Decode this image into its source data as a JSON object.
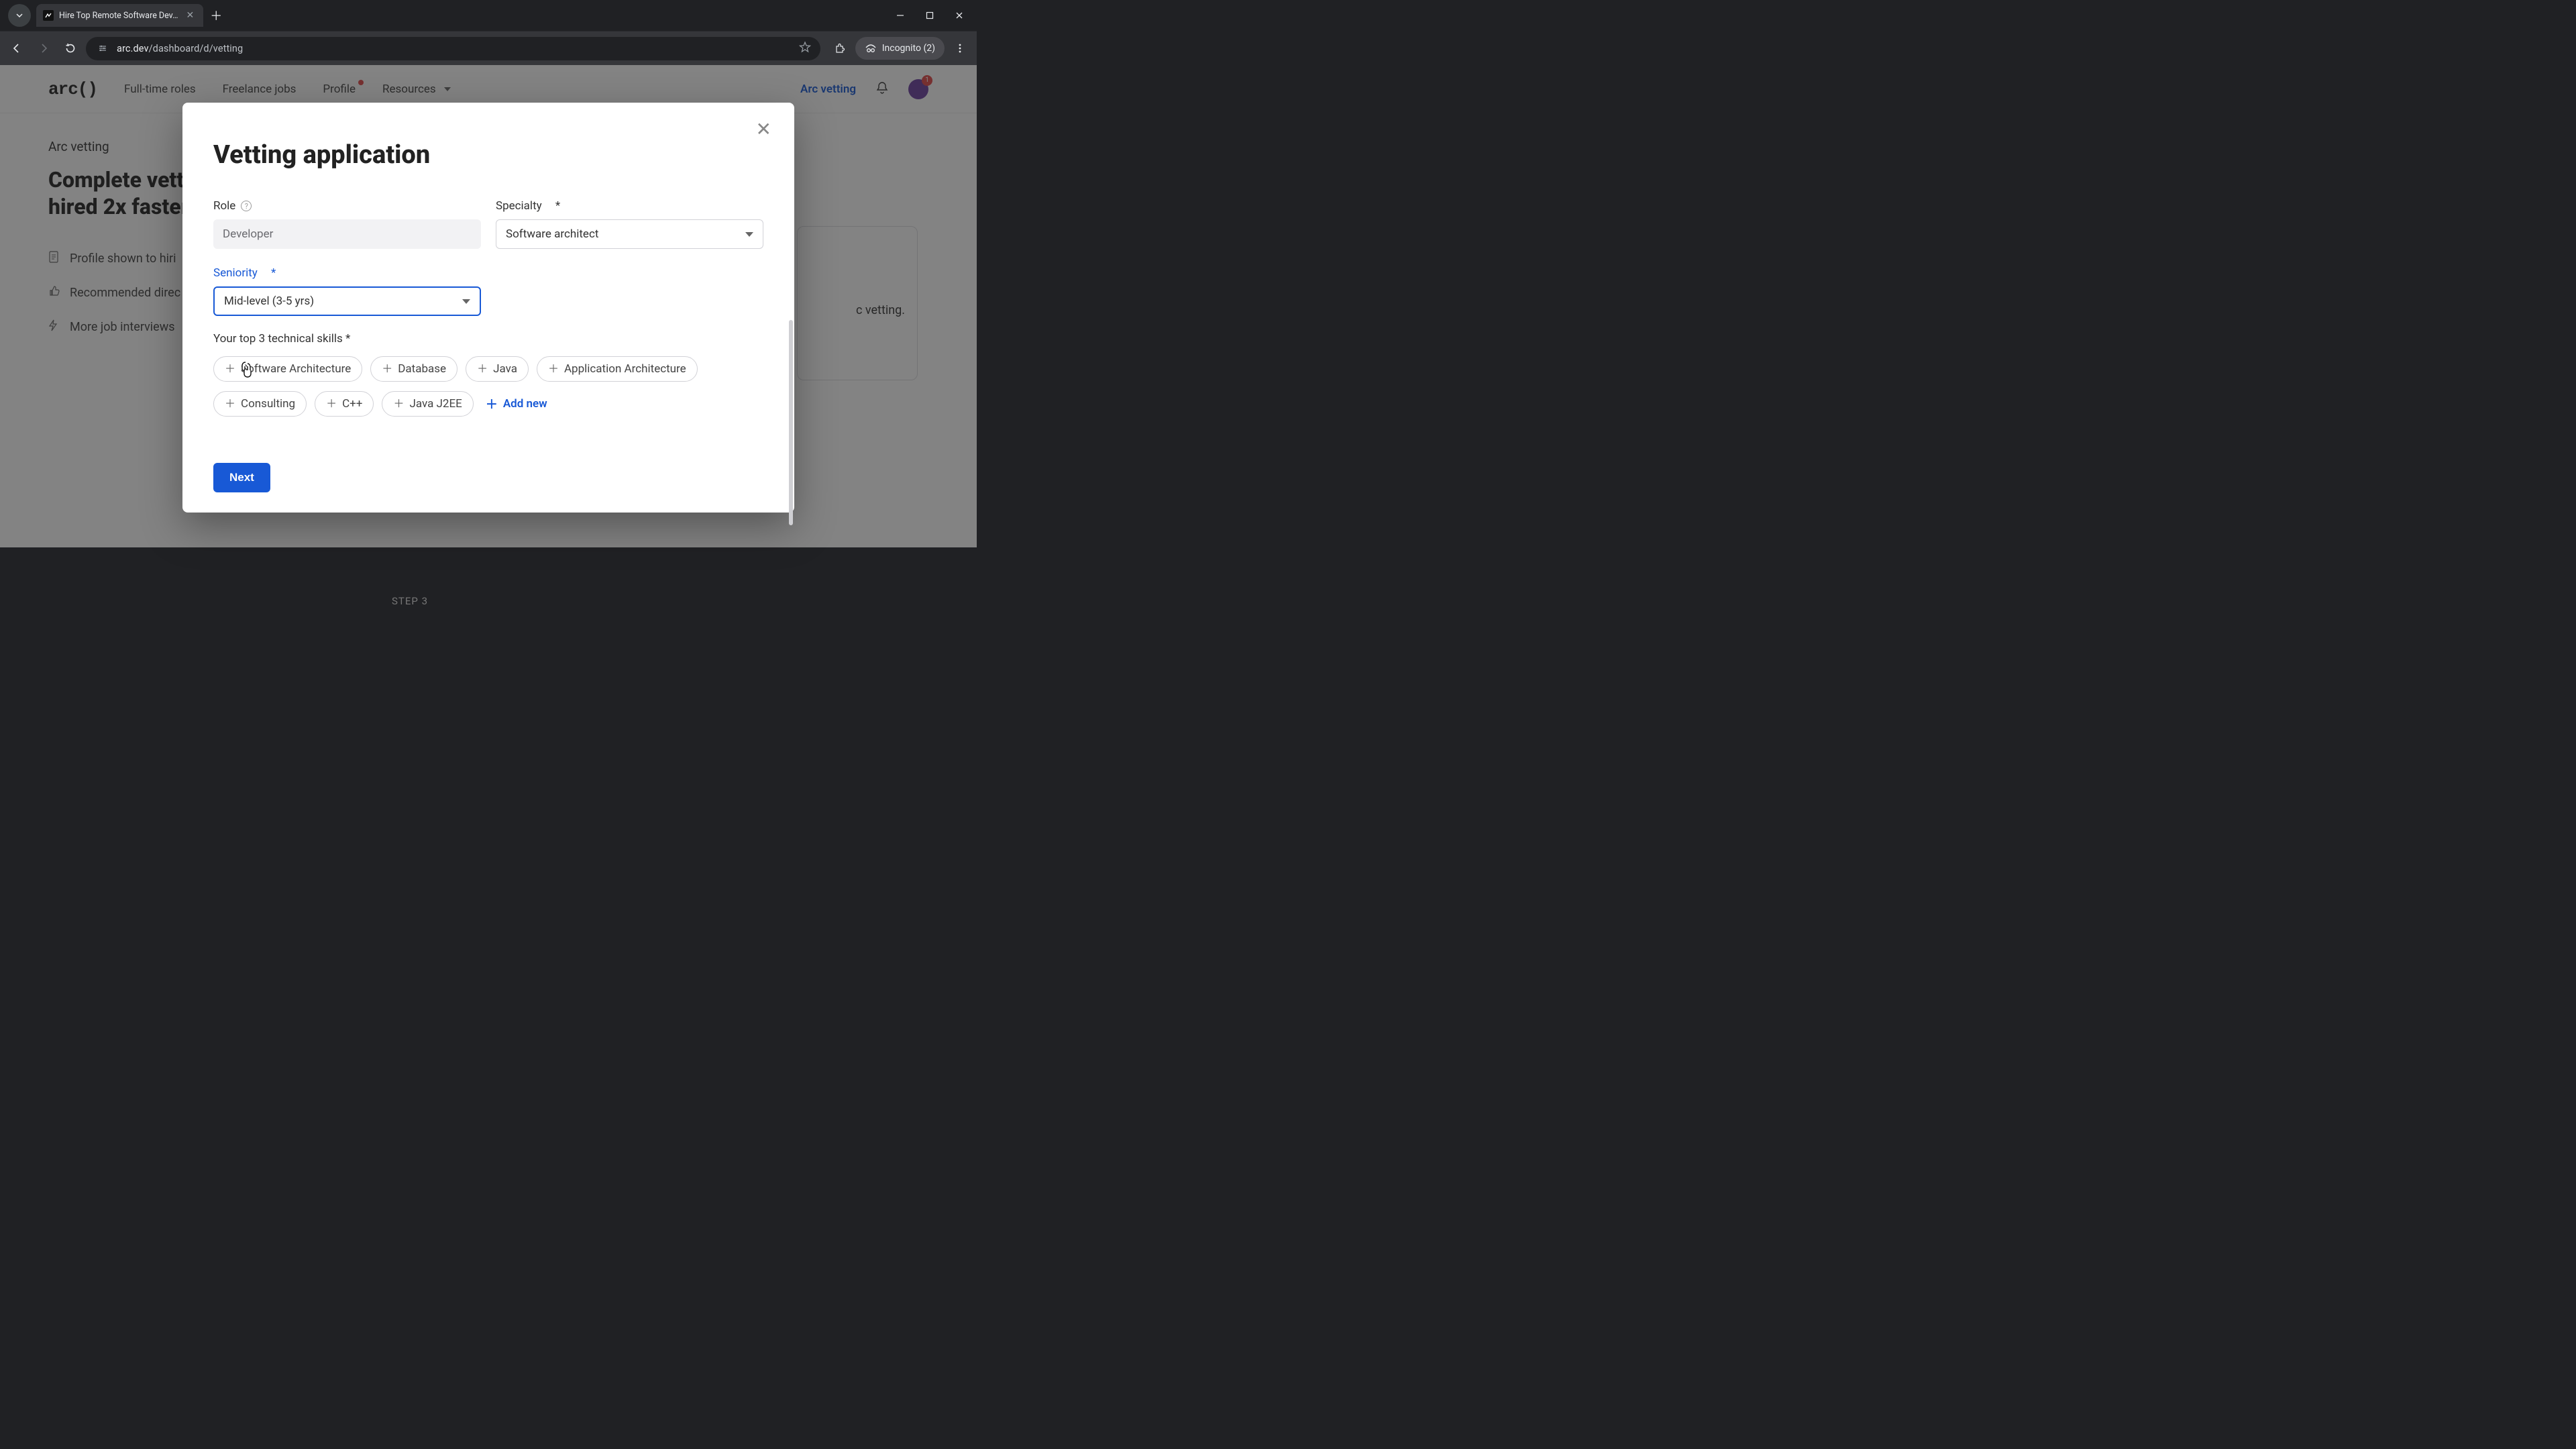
{
  "browser": {
    "tab_title": "Hire Top Remote Software Dev…",
    "url_display_host": "arc.dev",
    "url_display_path": "/dashboard/d/vetting",
    "incognito_label": "Incognito (2)"
  },
  "header": {
    "logo": "arc()",
    "nav": {
      "full_time": "Full-time roles",
      "freelance": "Freelance jobs",
      "profile": "Profile",
      "resources": "Resources"
    },
    "right": {
      "arc_vetting": "Arc vetting",
      "avatar_badge": "1"
    }
  },
  "page": {
    "section_label": "Arc vetting",
    "heading_line1": "Complete vetti",
    "heading_line2": "hired 2x faster",
    "benefits": {
      "profile": "Profile shown to hiri",
      "recommended": "Recommended direc",
      "interviews": "More job interviews"
    },
    "right_card_text": "c vetting.",
    "step_label": "STEP 3"
  },
  "modal": {
    "title": "Vetting application",
    "fields": {
      "role_label": "Role",
      "role_value": "Developer",
      "specialty_label": "Specialty",
      "specialty_value": "Software architect",
      "seniority_label": "Seniority",
      "seniority_value": "Mid-level (3-5 yrs)"
    },
    "skills_label": "Your top 3 technical skills",
    "skills": [
      "Software Architecture",
      "Database",
      "Java",
      "Application Architecture",
      "Consulting",
      "C++",
      "Java J2EE"
    ],
    "add_new_label": "Add new",
    "next_label": "Next"
  }
}
